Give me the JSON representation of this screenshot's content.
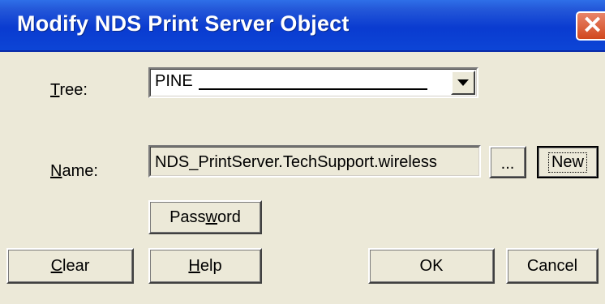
{
  "window": {
    "title": "Modify NDS Print Server Object",
    "close_glyph": "✕"
  },
  "tree": {
    "label_mnemonic": "T",
    "label_rest": "ree:",
    "value": "PINE"
  },
  "name": {
    "label_mnemonic": "N",
    "label_rest": "ame:",
    "value": "NDS_PrintServer.TechSupport.wireless",
    "browse_label": "...",
    "new_label": "New"
  },
  "password_button": {
    "before": "Pass",
    "mnemonic": "w",
    "after": "ord"
  },
  "buttons": {
    "clear_mnemonic": "C",
    "clear_rest": "lear",
    "help_mnemonic": "H",
    "help_rest": "elp",
    "ok_label": "OK",
    "cancel_label": "Cancel"
  }
}
